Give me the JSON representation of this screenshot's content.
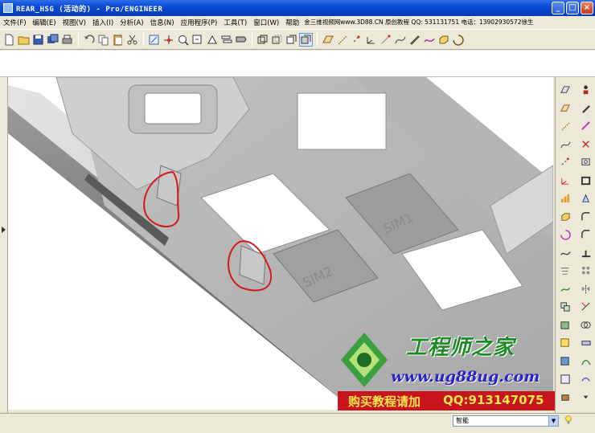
{
  "window": {
    "title": "REAR_HSG (活动的) - Pro/ENGINEER",
    "min_label": "_",
    "max_label": "□",
    "close_label": "×"
  },
  "menu": {
    "items": [
      {
        "label": "文件(F)"
      },
      {
        "label": "编辑(E)"
      },
      {
        "label": "视图(V)"
      },
      {
        "label": "插入(I)"
      },
      {
        "label": "分析(A)"
      },
      {
        "label": "信息(N)"
      },
      {
        "label": "应用程序(P)"
      },
      {
        "label": "工具(T)"
      },
      {
        "label": "窗口(W)"
      },
      {
        "label": "帮助"
      }
    ],
    "info": "金三维视频网www.3D88.CN 原创教程 QQ: 531131751 电话：13902930572徐生"
  },
  "toolbar": {
    "icons": [
      "new-file-icon",
      "open-folder-icon",
      "save-icon",
      "save-copy-icon",
      "print-icon",
      "separator",
      "undo-icon",
      "copy-icon",
      "paste-icon",
      "cut-icon",
      "separator",
      "repaint-icon",
      "spin-center-icon",
      "zoom-in-icon",
      "zoom-out-icon",
      "orient-icon",
      "layer-icon",
      "saved-views-icon",
      "separator",
      "wireframe-icon",
      "hidden-line-icon",
      "no-hidden-icon",
      "shading-icon",
      "separator",
      "datum-plane-icon",
      "datum-axis-icon",
      "datum-point-icon",
      "coord-sys-icon",
      "annotation-icon",
      "curve-icon",
      "sketch-icon",
      "spline-icon",
      "extrude-icon",
      "revolve-icon"
    ]
  },
  "model": {
    "sim_labels": [
      "SIM1",
      "SIM2"
    ]
  },
  "status": {
    "filter_value": "智能",
    "dropdown_glyph": "▼"
  },
  "watermark": {
    "title": "工程师之家",
    "url": "www.ug88ug.com",
    "buy": "购买教程请加",
    "qq": "QQ:913147075"
  },
  "colors": {
    "titlebar": "#0a4bd6",
    "highlight_circle": "#d81818",
    "watermark_green": "#1d8a28",
    "watermark_blue": "#2a23c8",
    "banner_red": "#c8141c",
    "banner_text": "#ffe64a"
  }
}
